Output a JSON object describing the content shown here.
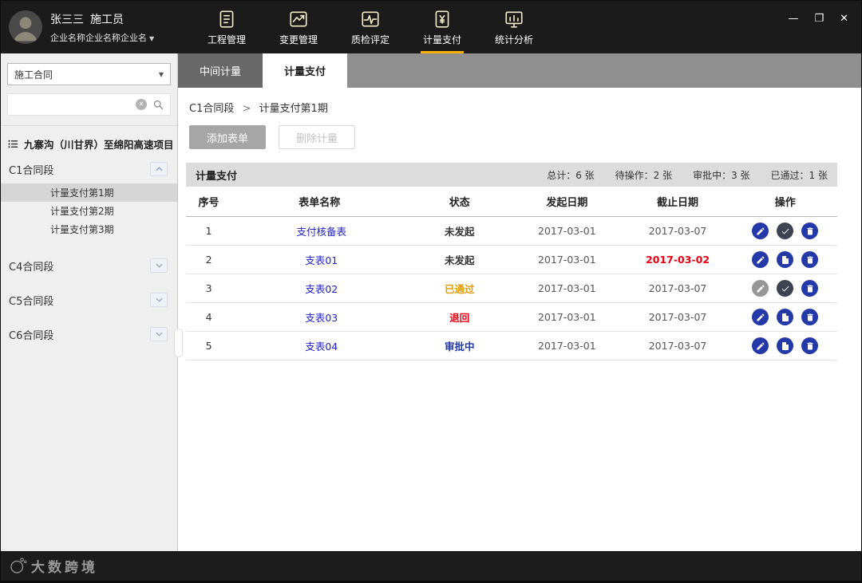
{
  "window_controls": {
    "minimize": "—",
    "restore": "❐",
    "close": "✕"
  },
  "topbar": {
    "accent_color": "#ffb000",
    "user": {
      "name": "张三三",
      "role": "施工员",
      "company": "企业名称企业名称企业名",
      "company_caret": "▼"
    },
    "nav_items": [
      {
        "label": "工程管理",
        "icon": "project-management-icon",
        "active": false
      },
      {
        "label": "变更管理",
        "icon": "change-management-icon",
        "active": false
      },
      {
        "label": "质检评定",
        "icon": "quality-inspection-icon",
        "active": false
      },
      {
        "label": "计量支付",
        "icon": "measurement-payment-icon",
        "active": true
      },
      {
        "label": "统计分析",
        "icon": "statistics-analysis-icon",
        "active": false
      }
    ]
  },
  "sidebar": {
    "contract_select_value": "施工合同",
    "contract_caret": "▼",
    "search_placeholder": "",
    "project_title": "九寨沟（川甘界）至绵阳高速项目",
    "tree": [
      {
        "label": "C1合同段",
        "expanded": true,
        "children": [
          {
            "label": "计量支付第1期",
            "selected": true
          },
          {
            "label": "计量支付第2期",
            "selected": false
          },
          {
            "label": "计量支付第3期",
            "selected": false
          }
        ]
      },
      {
        "label": "C4合同段",
        "expanded": false,
        "children": []
      },
      {
        "label": "C5合同段",
        "expanded": false,
        "children": []
      },
      {
        "label": "C6合同段",
        "expanded": false,
        "children": []
      }
    ]
  },
  "main": {
    "tabs": [
      {
        "label": "中间计量",
        "active": false
      },
      {
        "label": "计量支付",
        "active": true
      }
    ],
    "breadcrumb": {
      "parent": "C1合同段",
      "separator": ">",
      "current": "计量支付第1期"
    },
    "buttons": {
      "add": "添加表单",
      "delete": "删除计量"
    },
    "panel": {
      "title": "计量支付",
      "stats": [
        {
          "label": "总计",
          "value": "6 张"
        },
        {
          "label": "待操作",
          "value": "2 张"
        },
        {
          "label": "审批中",
          "value": "3 张"
        },
        {
          "label": "已通过",
          "value": "1 张"
        }
      ]
    },
    "table": {
      "link_color": "#2222cc",
      "headers": [
        "序号",
        "表单名称",
        "状态",
        "发起日期",
        "截止日期",
        "操作"
      ],
      "rows": [
        {
          "no": "1",
          "name": "支付核备表",
          "status": "未发起",
          "status_color": "#333333",
          "start_date": "2017-03-01",
          "end_date": "2017-03-07",
          "end_color": "#555555",
          "end_bold": false,
          "actions": [
            {
              "type": "edit",
              "color": "#2339a8"
            },
            {
              "type": "approve",
              "color": "#3c4351"
            },
            {
              "type": "delete",
              "color": "#2339a8"
            }
          ]
        },
        {
          "no": "2",
          "name": "支表01",
          "status": "未发起",
          "status_color": "#333333",
          "start_date": "2017-03-01",
          "end_date": "2017-03-02",
          "end_color": "#e60012",
          "end_bold": true,
          "actions": [
            {
              "type": "edit",
              "color": "#2339a8"
            },
            {
              "type": "submit",
              "color": "#2339a8"
            },
            {
              "type": "delete",
              "color": "#2339a8"
            }
          ]
        },
        {
          "no": "3",
          "name": "支表02",
          "status": "已通过",
          "status_color": "#e39b00",
          "start_date": "2017-03-01",
          "end_date": "2017-03-07",
          "end_color": "#555555",
          "end_bold": false,
          "actions": [
            {
              "type": "edit",
              "color": "#969696"
            },
            {
              "type": "approve",
              "color": "#3c4351"
            },
            {
              "type": "delete",
              "color": "#2339a8"
            }
          ]
        },
        {
          "no": "4",
          "name": "支表03",
          "status": "退回",
          "status_color": "#e60012",
          "start_date": "2017-03-01",
          "end_date": "2017-03-07",
          "end_color": "#555555",
          "end_bold": false,
          "actions": [
            {
              "type": "edit",
              "color": "#2339a8"
            },
            {
              "type": "submit",
              "color": "#2339a8"
            },
            {
              "type": "delete",
              "color": "#2339a8"
            }
          ]
        },
        {
          "no": "5",
          "name": "支表04",
          "status": "审批中",
          "status_color": "#2339a8",
          "start_date": "2017-03-01",
          "end_date": "2017-03-07",
          "end_color": "#555555",
          "end_bold": false,
          "actions": [
            {
              "type": "edit",
              "color": "#2339a8"
            },
            {
              "type": "submit",
              "color": "#2339a8"
            },
            {
              "type": "delete",
              "color": "#2339a8"
            }
          ]
        }
      ]
    }
  },
  "footer": {
    "watermark_text": "大数跨境"
  }
}
